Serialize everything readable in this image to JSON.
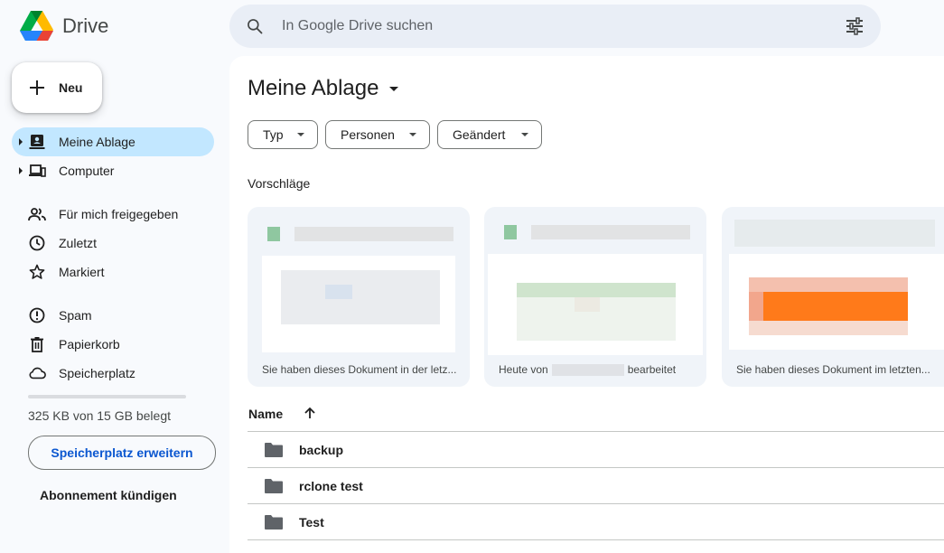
{
  "app": {
    "name": "Drive"
  },
  "search": {
    "placeholder": "In Google Drive suchen"
  },
  "new_button": {
    "label": "Neu"
  },
  "sidebar": {
    "items": [
      {
        "label": "Meine Ablage",
        "icon": "my-drive-icon",
        "active": true
      },
      {
        "label": "Computer",
        "icon": "computer-icon"
      },
      {
        "label": "Für mich freigegeben",
        "icon": "people-icon"
      },
      {
        "label": "Zuletzt",
        "icon": "clock-icon"
      },
      {
        "label": "Markiert",
        "icon": "star-icon"
      },
      {
        "label": "Spam",
        "icon": "spam-icon"
      },
      {
        "label": "Papierkorb",
        "icon": "trash-icon"
      },
      {
        "label": "Speicherplatz",
        "icon": "cloud-icon"
      }
    ],
    "storage": {
      "text": "325 KB von 15 GB belegt",
      "used_fraction": 2e-05
    },
    "expand_label": "Speicherplatz erweitern",
    "cancel_label": "Abonnement kündigen"
  },
  "main": {
    "title": "Meine Ablage",
    "filters": [
      "Typ",
      "Personen",
      "Geändert"
    ],
    "suggestions_label": "Vorschläge",
    "suggestions": [
      {
        "caption": "Sie haben dieses Dokument in der letz..."
      },
      {
        "caption_prefix": "Heute von",
        "caption_suffix": "bearbeitet"
      },
      {
        "caption": "Sie haben dieses Dokument im letzten..."
      }
    ],
    "column_name": "Name",
    "files": [
      {
        "name": "backup"
      },
      {
        "name": "rclone test"
      },
      {
        "name": "Test"
      }
    ]
  },
  "colors": {
    "accent": "#0b57d0",
    "active_nav": "#c2e7ff",
    "background": "#f8fafd",
    "folder": "#5f6368"
  }
}
